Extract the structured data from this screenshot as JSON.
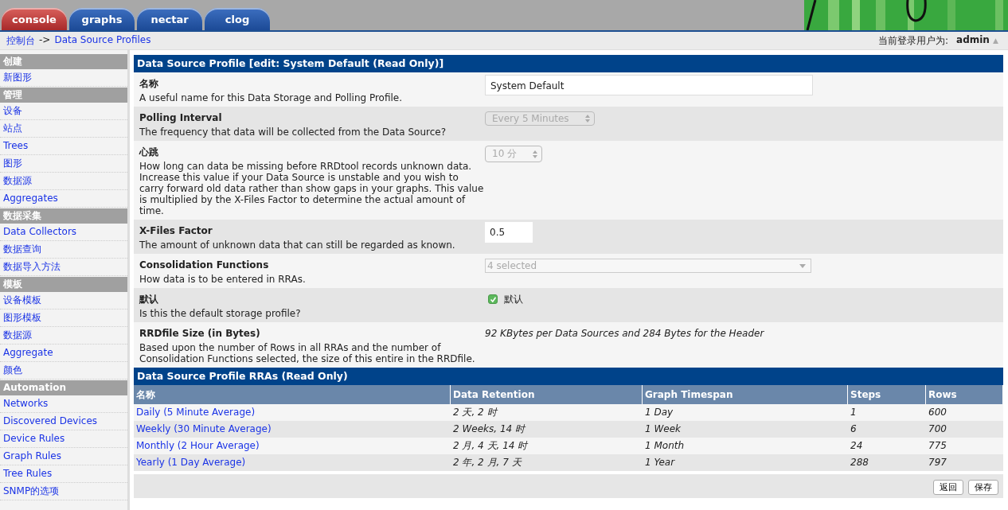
{
  "tabs": [
    {
      "label": "console",
      "selected": true
    },
    {
      "label": "graphs",
      "selected": false
    },
    {
      "label": "nectar",
      "selected": false
    },
    {
      "label": "clog",
      "selected": false
    }
  ],
  "breadcrumb": {
    "link": "控制台",
    "separator": "->",
    "current": "Data Source Profiles"
  },
  "user": {
    "label": "当前登录用户为:",
    "name": "admin",
    "caret": "▲"
  },
  "sidebar": [
    {
      "header": "创建",
      "items": [
        "新图形"
      ]
    },
    {
      "header": "管理",
      "items": [
        "设备",
        "站点",
        "Trees",
        "图形",
        "数据源",
        "Aggregates"
      ]
    },
    {
      "header": "数据采集",
      "items": [
        "Data Collectors",
        "数据查询",
        "数据导入方法"
      ]
    },
    {
      "header": "模板",
      "items": [
        "设备模板",
        "图形模板",
        "数据源",
        "Aggregate",
        "颜色"
      ]
    },
    {
      "header": "Automation",
      "items": [
        "Networks",
        "Discovered Devices",
        "Device Rules",
        "Graph Rules",
        "Tree Rules",
        "SNMP的选项"
      ]
    }
  ],
  "form": {
    "title": "Data Source Profile [edit: System Default (Read Only)]",
    "rows": [
      {
        "kind": "text",
        "label": "名称",
        "description": "A useful name for this Data Storage and Polling Profile.",
        "value": "System Default"
      },
      {
        "kind": "select",
        "label": "Polling Interval",
        "description": "The frequency that data will be collected from the Data Source?",
        "value": "Every 5 Minutes"
      },
      {
        "kind": "select",
        "label": "心跳",
        "description": "How long can data be missing before RRDtool records unknown data. Increase this value if your Data Source is unstable and you wish to carry forward old data rather than show gaps in your graphs. This value is multiplied by the X-Files Factor to determine the actual amount of time.",
        "value": "10 分"
      },
      {
        "kind": "number",
        "label": "X-Files Factor",
        "description": "The amount of unknown data that can still be regarded as known.",
        "value": "0.5"
      },
      {
        "kind": "multiselect",
        "label": "Consolidation Functions",
        "description": "How data is to be entered in RRAs.",
        "value": "4 selected"
      },
      {
        "kind": "checkbox",
        "label": "默认",
        "description": "Is this the default storage profile?",
        "value": "默认",
        "checked": true
      },
      {
        "kind": "static",
        "label": "RRDfile Size (in Bytes)",
        "description": "Based upon the number of Rows in all RRAs and the number of Consolidation Functions selected, the size of this entire in the RRDfile.",
        "value": "92 KBytes per Data Sources and 284 Bytes for the Header"
      }
    ]
  },
  "rra": {
    "title": "Data Source Profile RRAs (Read Only)",
    "columns": [
      "名称",
      "Data Retention",
      "Graph Timespan",
      "Steps",
      "Rows"
    ],
    "rows": [
      [
        "Daily (5 Minute Average)",
        "2 天, 2 时",
        "1 Day",
        "1",
        "600"
      ],
      [
        "Weekly (30 Minute Average)",
        "2 Weeks, 14 时",
        "1 Week",
        "6",
        "700"
      ],
      [
        "Monthly (2 Hour Average)",
        "2 月, 4 天, 14 时",
        "1 Month",
        "24",
        "775"
      ],
      [
        "Yearly (1 Day Average)",
        "2 年, 2 月, 7 天",
        "1 Year",
        "288",
        "797"
      ]
    ]
  },
  "buttons": [
    "返回",
    "保存"
  ]
}
